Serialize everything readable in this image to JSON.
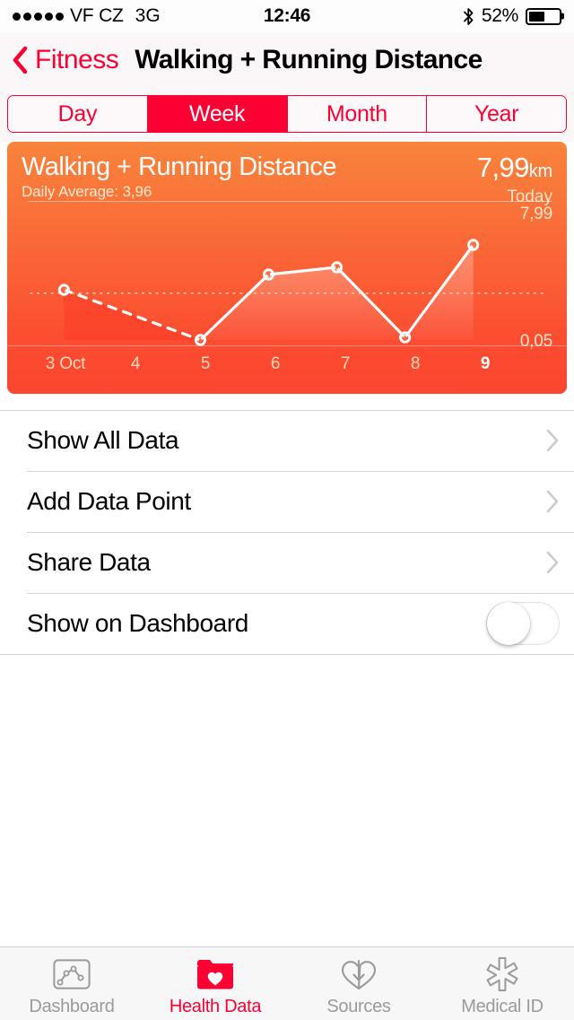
{
  "status_bar": {
    "signal_dots": 5,
    "carrier": "VF CZ",
    "network": "3G",
    "time": "12:46",
    "bluetooth_icon": "bluetooth-icon",
    "battery_percent": "52%",
    "battery_level": 52
  },
  "nav": {
    "back_icon": "chevron-left-icon",
    "back_label": "Fitness",
    "title": "Walking + Running Distance"
  },
  "segmented": {
    "options": [
      "Day",
      "Week",
      "Month",
      "Year"
    ],
    "selected": "Week",
    "accent": "#fb0033"
  },
  "card": {
    "title": "Walking + Running Distance",
    "subtitle": "Daily Average: 3,96",
    "value": "7,99",
    "unit": "km",
    "value_caption": "Today",
    "gradient_top": "#f8843c",
    "gradient_bottom": "#fd4530"
  },
  "chart_data": {
    "type": "line",
    "title": "Walking + Running Distance",
    "xlabel": "",
    "ylabel": "km",
    "categories": [
      "3 Oct",
      "4",
      "5",
      "6",
      "7",
      "8",
      "9"
    ],
    "x_tick_labels": [
      "3 Oct",
      "4",
      "5",
      "6",
      "7",
      "8",
      "9"
    ],
    "highlighted_tick": "9",
    "y_axis_top_label": "7,99",
    "y_axis_bottom_label": "0,05",
    "ylim": [
      0.05,
      7.99
    ],
    "grid": false,
    "legend": "none",
    "average_line": {
      "label": "Daily Average",
      "value": 3.96,
      "style": "dotted"
    },
    "series": [
      {
        "name": "Walking + Running Distance",
        "unit": "km",
        "values": [
          4.24,
          null,
          0.05,
          5.52,
          6.12,
          0.27,
          7.99
        ],
        "missing_segment_style": "dashed",
        "missing_between": [
          "3 Oct",
          "5"
        ]
      }
    ]
  },
  "list": {
    "rows": [
      {
        "label": "Show All Data",
        "accessory": "chevron-right-icon"
      },
      {
        "label": "Add Data Point",
        "accessory": "chevron-right-icon"
      },
      {
        "label": "Share Data",
        "accessory": "chevron-right-icon"
      },
      {
        "label": "Show on Dashboard",
        "accessory": "toggle",
        "toggle_on": false
      }
    ]
  },
  "tabbar": {
    "items": [
      {
        "label": "Dashboard",
        "icon": "dashboard-chart-icon",
        "active": false
      },
      {
        "label": "Health Data",
        "icon": "folder-heart-icon",
        "active": true
      },
      {
        "label": "Sources",
        "icon": "heart-download-icon",
        "active": false
      },
      {
        "label": "Medical ID",
        "icon": "medical-asterisk-icon",
        "active": false
      }
    ],
    "active_color": "#fb0033",
    "inactive_color": "#9a9a9a"
  }
}
